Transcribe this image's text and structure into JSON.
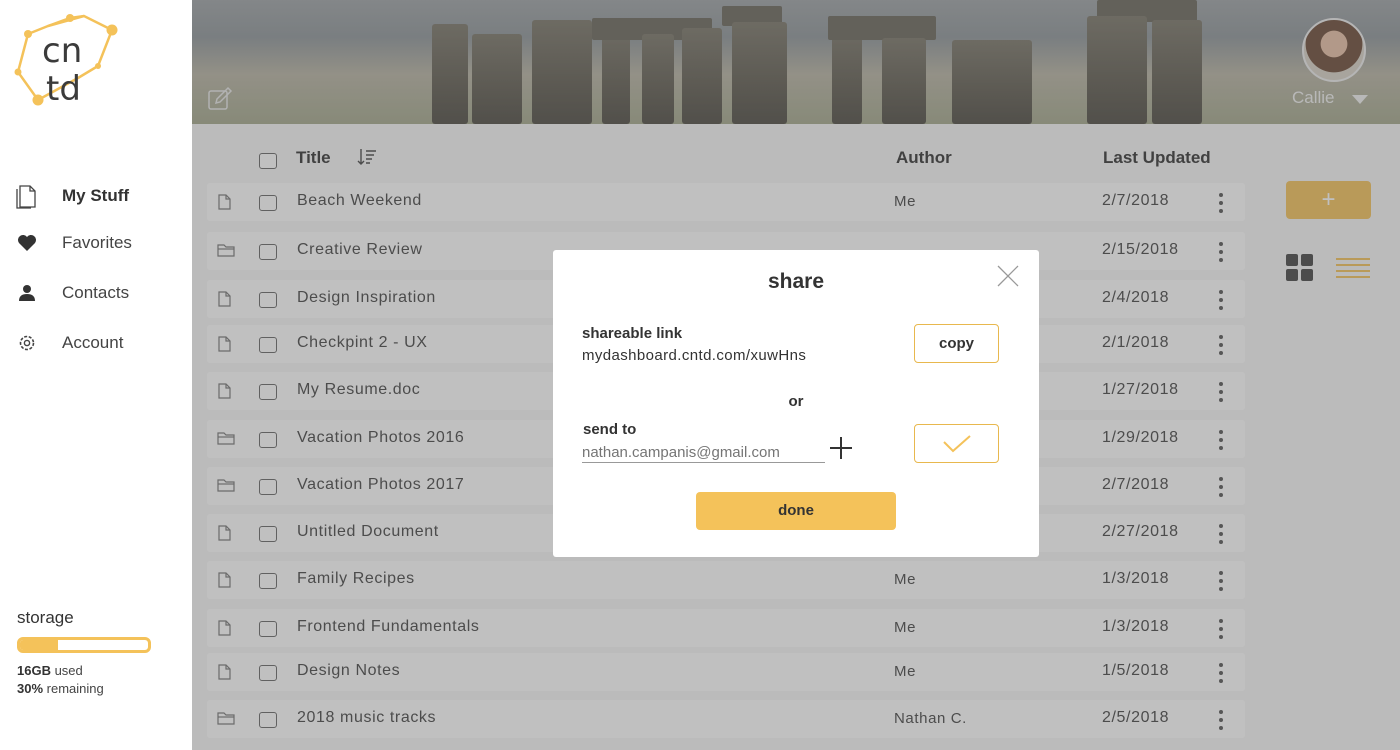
{
  "logo": {
    "line1": "cn",
    "line2": "td"
  },
  "sidebar": {
    "items": [
      {
        "label": "My Stuff",
        "icon": "document-icon",
        "active": true
      },
      {
        "label": "Favorites",
        "icon": "heart-icon"
      },
      {
        "label": "Contacts",
        "icon": "person-icon"
      },
      {
        "label": "Account",
        "icon": "gear-icon"
      }
    ]
  },
  "storage": {
    "title": "storage",
    "used_value": "16GB",
    "used_suffix": " used",
    "remaining_value": "30%",
    "remaining_suffix": " remaining",
    "used_fraction": 0.3
  },
  "user": {
    "name": "Callie"
  },
  "table": {
    "headers": {
      "title": "Title",
      "author": "Author",
      "updated": "Last Updated"
    },
    "rows": [
      {
        "type": "file",
        "title": "Beach Weekend",
        "author": "Me",
        "date": "2/7/2018"
      },
      {
        "type": "folder",
        "title": "Creative Review",
        "author": "",
        "date": "2/15/2018"
      },
      {
        "type": "file",
        "title": "Design Inspiration",
        "author": "",
        "date": "2/4/2018"
      },
      {
        "type": "file",
        "title": "Checkpint 2 - UX",
        "author": "",
        "date": "2/1/2018"
      },
      {
        "type": "file",
        "title": "My Resume.doc",
        "author": "",
        "date": "1/27/2018"
      },
      {
        "type": "folder",
        "title": "Vacation Photos 2016",
        "author": "",
        "date": "1/29/2018"
      },
      {
        "type": "folder",
        "title": "Vacation Photos 2017",
        "author": "",
        "date": "2/7/2018"
      },
      {
        "type": "file",
        "title": "Untitled Document",
        "author": "",
        "date": "2/27/2018"
      },
      {
        "type": "file",
        "title": "Family Recipes",
        "author": "Me",
        "date": "1/3/2018"
      },
      {
        "type": "file",
        "title": "Frontend Fundamentals",
        "author": "Me",
        "date": "1/3/2018"
      },
      {
        "type": "file",
        "title": "Design Notes",
        "author": "Me",
        "date": "1/5/2018"
      },
      {
        "type": "folder",
        "title": "2018 music tracks",
        "author": "Nathan C.",
        "date": "2/5/2018"
      }
    ]
  },
  "toolbar": {
    "add_label": "+"
  },
  "modal": {
    "title": "share",
    "link_label": "shareable link",
    "link_value": "mydashboard.cntd.com/xuwHns",
    "copy_label": "copy",
    "or_label": "or",
    "send_label": "send to",
    "email_placeholder": "nathan.campanis@gmail.com",
    "done_label": "done"
  },
  "colors": {
    "accent": "#f4c25a",
    "text": "#333333",
    "overlay": "rgba(90,90,90,0.38)"
  }
}
